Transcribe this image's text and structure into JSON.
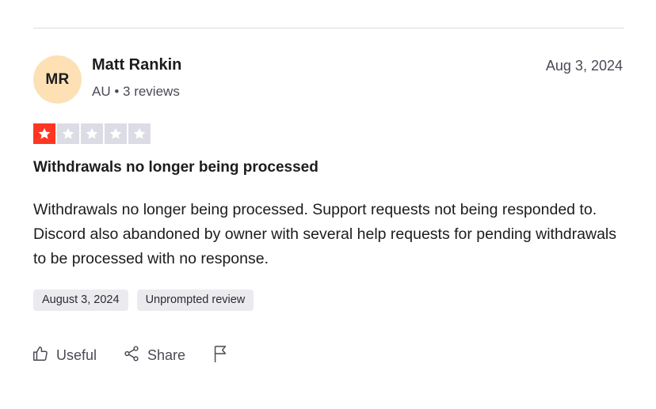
{
  "reviewer": {
    "initials": "MR",
    "name": "Matt Rankin",
    "meta": "AU • 3 reviews"
  },
  "review": {
    "date": "Aug 3, 2024",
    "rating": 1,
    "max_rating": 5,
    "title": "Withdrawals no longer being processed",
    "body": "Withdrawals no longer being processed. Support requests not being responded to. Discord also abandoned by owner with several help requests for pending withdrawals to be processed with no response.",
    "tags": [
      "August 3, 2024",
      "Unprompted review"
    ]
  },
  "actions": {
    "useful_label": "Useful",
    "share_label": "Share"
  },
  "icons": {
    "star": "star-icon",
    "useful": "thumbs-up-icon",
    "share": "share-icon",
    "report": "flag-icon"
  },
  "colors": {
    "star_filled": "#ff3722",
    "star_empty": "#dcdce6",
    "avatar_bg": "#fde1b5"
  }
}
